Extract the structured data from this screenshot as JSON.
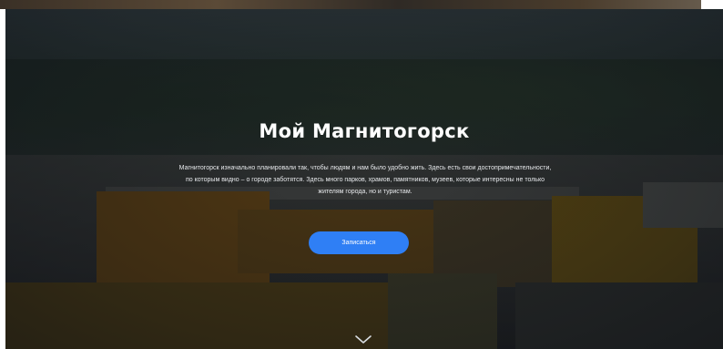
{
  "hero": {
    "title": "Мой Магнитогорск",
    "description": "Магнитогорск изначально планировали так, чтобы людям и нам было удобно жить. Здесь есть свои достопримечательности, по которым видно – о городе заботятся. Здесь много парков, храмов, памятников, музеев, которые интересны не только жителям города, но и туристам.",
    "button_label": "Записаться",
    "scroll_icon": "chevron-down-icon"
  },
  "colors": {
    "button": "#2f7ff5",
    "title": "#ffffff",
    "overlay": "#0a0e14"
  }
}
